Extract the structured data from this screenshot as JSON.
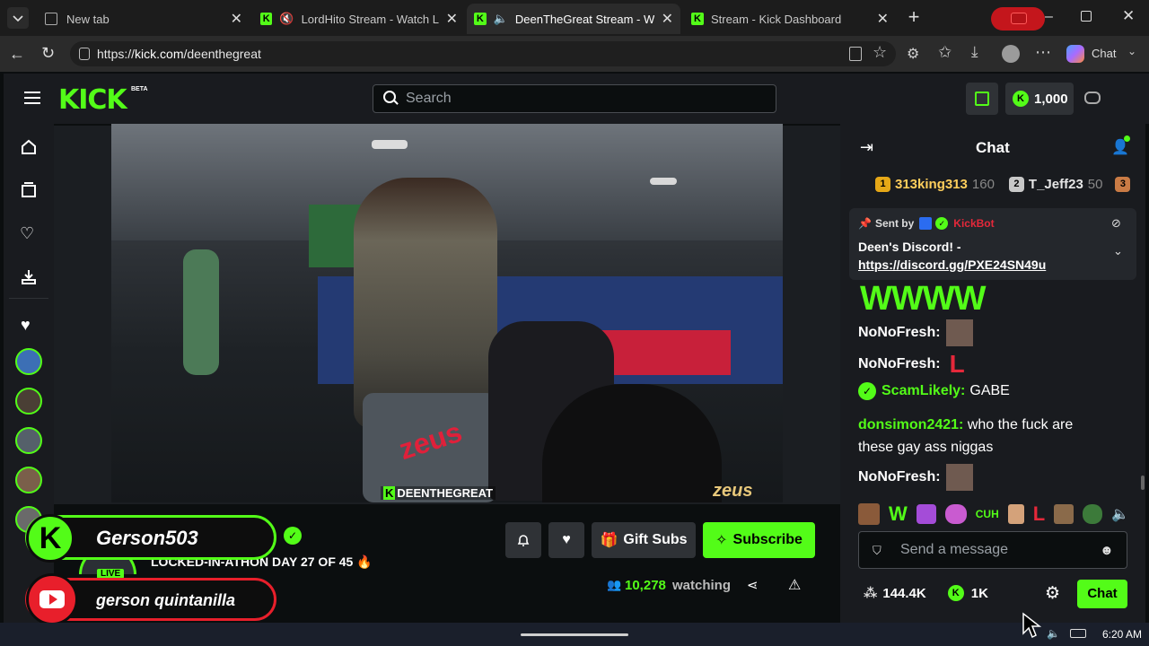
{
  "browser": {
    "tabs": [
      {
        "title": "New tab"
      },
      {
        "title": "LordHito Stream - Watch Live"
      },
      {
        "title": "DeenTheGreat Stream - Watch"
      },
      {
        "title": "Stream - Kick Dashboard"
      }
    ],
    "url_prefix": "https://",
    "url_domain": "kick.com",
    "url_path": "/deenthegreat",
    "profile_label": "Chat"
  },
  "kick": {
    "logo": "KICK",
    "beta": "BETA",
    "search_placeholder": "Search",
    "points": "1,000",
    "accent": "#53fc18"
  },
  "video": {
    "watermark_left": "DEENTHEGREAT",
    "watermark_right": "zeus"
  },
  "stream": {
    "title": "LOCKED-IN-ATHON DAY 27 OF 45 🔥",
    "live_label": "LIVE",
    "gift_subs": "Gift Subs",
    "subscribe": "Subscribe",
    "viewers": "10,278",
    "watching": "watching"
  },
  "overlay": {
    "kick_name": "Gerson503",
    "youtube_name": "gerson quintanilla"
  },
  "chat": {
    "header": "Chat",
    "leaderboard": [
      {
        "rank": "1",
        "name": "313king313",
        "count": "160"
      },
      {
        "rank": "2",
        "name": "T_Jeff23",
        "count": "50"
      },
      {
        "rank": "3",
        "name": "",
        "count": ""
      }
    ],
    "pinned": {
      "sent_by": "Sent by",
      "bot": "KickBot",
      "text": "Deen's Discord! -",
      "link": "https://discord.gg/PXE24SN49u"
    },
    "emote_text": "WWWW",
    "messages": [
      {
        "user": "NoNoFresh:",
        "text": "",
        "color": "#ffffff"
      },
      {
        "user": "NoNoFresh:",
        "text": "L",
        "color": "#ffffff"
      },
      {
        "user": "ScamLikely:",
        "text": "GABE",
        "color": "#53fc18"
      },
      {
        "user": "donsimon2421:",
        "text": "who the fuck are",
        "text2": "these gay ass niggas",
        "color": "#53fc18"
      },
      {
        "user": "NoNoFresh:",
        "text": "",
        "color": "#ffffff"
      }
    ],
    "emote_bar": [
      "W",
      "CUH",
      "L"
    ],
    "input_placeholder": "Send a message",
    "followers": "144.4K",
    "kicks": "1K",
    "chat_button": "Chat"
  },
  "taskbar": {
    "time": "6:20 AM"
  }
}
